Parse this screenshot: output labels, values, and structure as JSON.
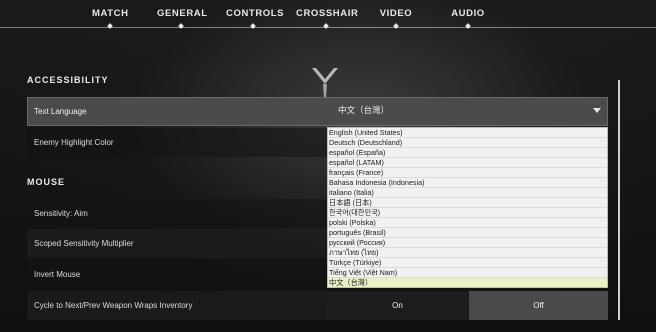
{
  "tabs": [
    {
      "label": "MATCH"
    },
    {
      "label": "GENERAL"
    },
    {
      "label": "CONTROLS"
    },
    {
      "label": "CROSSHAIR"
    },
    {
      "label": "VIDEO"
    },
    {
      "label": "AUDIO"
    }
  ],
  "sections": {
    "accessibility": "ACCESSIBILITY",
    "mouse": "MOUSE"
  },
  "settings": {
    "text_language": {
      "label": "Text Language",
      "value": "中文（台灣）"
    },
    "enemy_highlight": {
      "label": "Enemy Highlight Color"
    },
    "sensitivity_aim": {
      "label": "Sensitivity: Aim"
    },
    "scoped_sensitivity": {
      "label": "Scoped Sensitivity Multiplier"
    },
    "invert_mouse": {
      "label": "Invert Mouse"
    },
    "cycle_weapon": {
      "label": "Cycle to Next/Prev Weapon Wraps Inventory",
      "on": "On",
      "off": "Off"
    }
  },
  "language_options": [
    "English (United States)",
    "Deutsch (Deutschland)",
    "español (España)",
    "español (LATAM)",
    "français (France)",
    "Bahasa Indonesia (Indonesia)",
    "italiano (Italia)",
    "日本語 (日本)",
    "한국어(대한민국)",
    "polski (Polska)",
    "português (Brasil)",
    "русский (Россия)",
    "ภาษาไทย (ไทย)",
    "Türkçe (Türkiye)",
    "Tiếng Việt (Việt Nam)",
    "中文（台灣）"
  ],
  "selected_language_index": 15
}
